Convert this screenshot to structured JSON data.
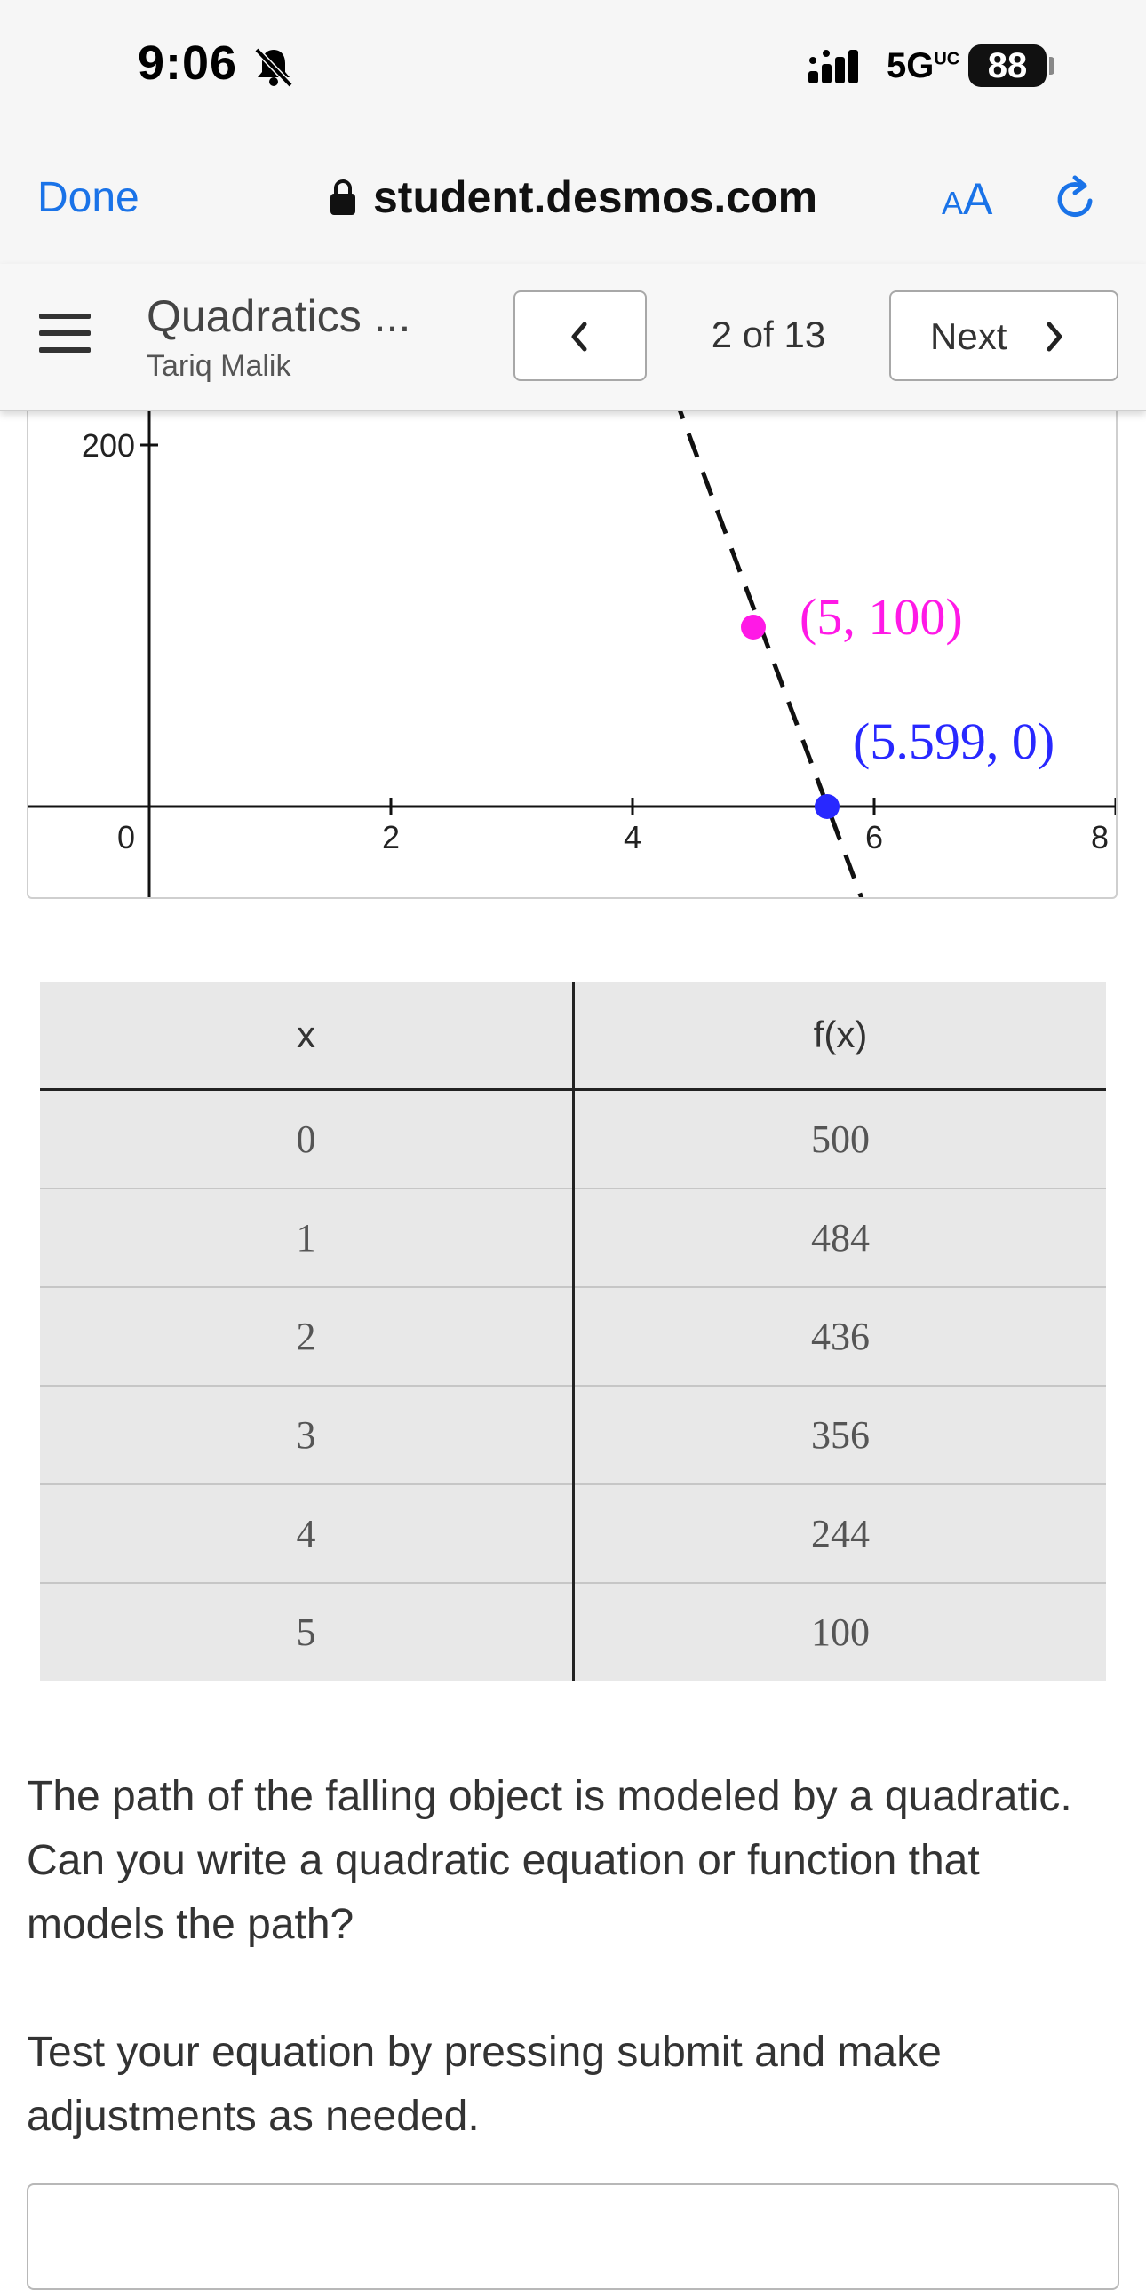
{
  "status_bar": {
    "time": "9:06",
    "network": "5G",
    "network_superscript": "UC",
    "battery": "88"
  },
  "browser": {
    "done_label": "Done",
    "url": "student.desmos.com",
    "text_size_label_small": "A",
    "text_size_label_large": "A"
  },
  "activity": {
    "title": "Quadratics ...",
    "author": "Tariq Malik",
    "page_counter": "2 of 13",
    "next_label": "Next"
  },
  "graph": {
    "y_tick_label": "200",
    "x_tick_labels": [
      "0",
      "2",
      "4",
      "6",
      "8"
    ],
    "point_magenta_label": "(5, 100)",
    "point_blue_label": "(5.599, 0)",
    "colors": {
      "magenta": "#ff19e6",
      "blue": "#2828ff",
      "line": "#111111"
    }
  },
  "table": {
    "headers": [
      "x",
      "f(x)"
    ],
    "rows": [
      [
        "0",
        "500"
      ],
      [
        "1",
        "484"
      ],
      [
        "2",
        "436"
      ],
      [
        "3",
        "356"
      ],
      [
        "4",
        "244"
      ],
      [
        "5",
        "100"
      ]
    ]
  },
  "prompt": {
    "question": "The path of the falling object is modeled by a quadratic.  Can you write a quadratic equation or function that models the path?",
    "instruction": "Test your equation by pressing submit and make adjustments as needed."
  }
}
